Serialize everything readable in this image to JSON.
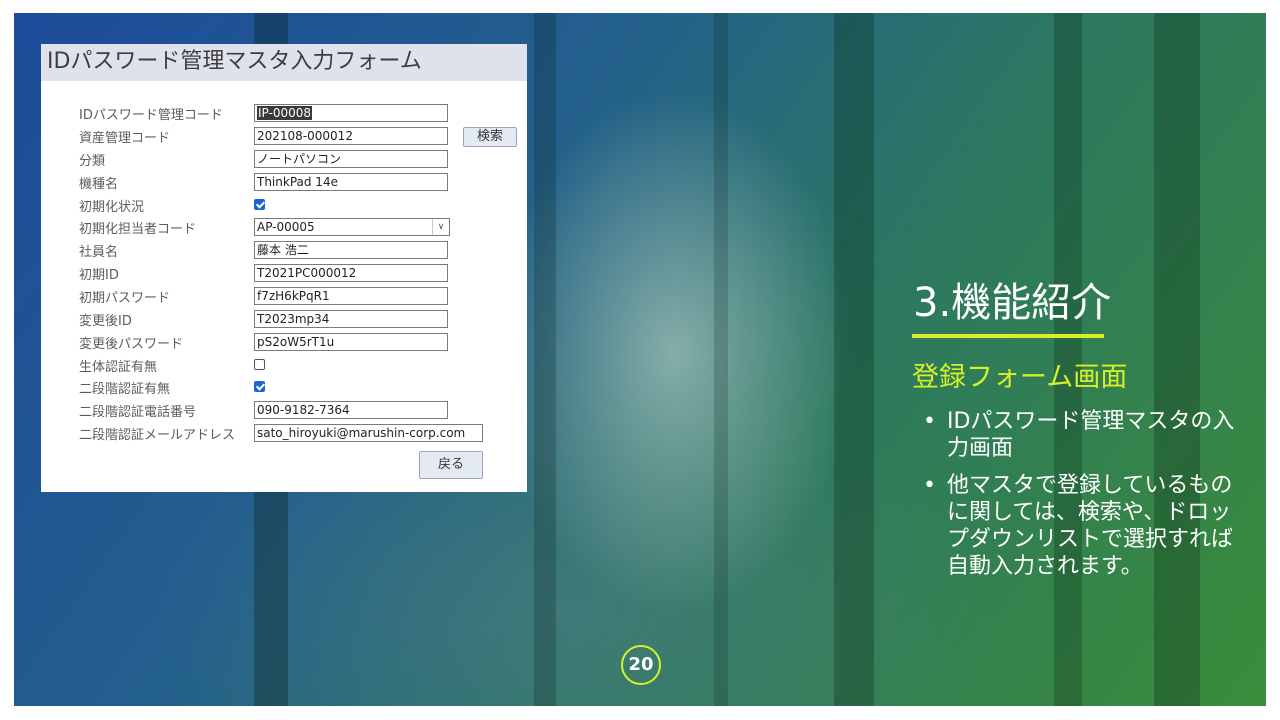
{
  "form": {
    "title": "IDパスワード管理マスタ入力フォーム",
    "fields": [
      {
        "label": "IDパスワード管理コード",
        "value": "IP-00008"
      },
      {
        "label": "資産管理コード",
        "value": "202108-000012"
      },
      {
        "label": "分類",
        "value": "ノートパソコン"
      },
      {
        "label": "機種名",
        "value": "ThinkPad 14e"
      },
      {
        "label": "初期化状況",
        "checked": true
      },
      {
        "label": "初期化担当者コード",
        "value": "AP-00005"
      },
      {
        "label": "社員名",
        "value": "藤本 浩二"
      },
      {
        "label": "初期ID",
        "value": "T2021PC000012"
      },
      {
        "label": "初期パスワード",
        "value": "f7zH6kPqR1"
      },
      {
        "label": "変更後ID",
        "value": "T2023mp34"
      },
      {
        "label": "変更後パスワード",
        "value": "pS2oW5rT1u"
      },
      {
        "label": "生体認証有無",
        "checked": false
      },
      {
        "label": "二段階認証有無",
        "checked": true
      },
      {
        "label": "二段階認証電話番号",
        "value": "090-9182-7364"
      },
      {
        "label": "二段階認証メールアドレス",
        "value": "sato_hiroyuki@marushin-corp.com"
      }
    ],
    "search_button": "検索",
    "back_button": "戻る"
  },
  "slide": {
    "section_title": "3.機能紹介",
    "subtitle": "登録フォーム画面",
    "bullets": [
      "IDパスワード管理マスタの入力画面",
      "他マスタで登録しているものに関しては、検索や、ドロップダウンリストで選択すれば自動入力されます。"
    ],
    "bullet_symbol": "•",
    "page_number": "20"
  },
  "colors": {
    "accent": "#d7ef2a",
    "checkbox_on": "#1a66d2",
    "form_title_bg": "#dfe2ec"
  }
}
